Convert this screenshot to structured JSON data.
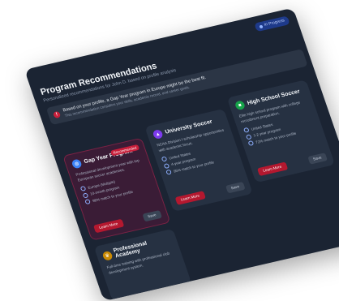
{
  "top_badge": "In Progress",
  "page": {
    "title": "Program Recommendations",
    "subtitle": "Personalized recommendations for John D. based on profile analysis"
  },
  "alert": {
    "title": "Based on your profile, a Gap Year program in Europe might be the best fit.",
    "subtitle": "This recommendation considers your skills, academic record, and career goals."
  },
  "cards": [
    {
      "title": "Gap Year Program",
      "badge": "Recommended",
      "desc": "Professional development year with top European soccer academies.",
      "items": [
        "Europe (Multiple)",
        "10-month program",
        "98% match to your profile"
      ],
      "learn_label": "Learn More",
      "save_label": "Save",
      "icon": "globe-icon",
      "icon_color": "#3b82f6"
    },
    {
      "title": "University Soccer",
      "desc": "NCAA Division I scholarship opportunities with academic focus.",
      "items": [
        "United States",
        "4-year program",
        "95% match to your profile"
      ],
      "learn_label": "Learn More",
      "save_label": "Save",
      "icon": "graduation-cap-icon",
      "icon_color": "#7c3aed"
    },
    {
      "title": "High School Soccer",
      "desc": "Elite high school program with college recruitment preparation.",
      "items": [
        "United States",
        "1-2 year program",
        "72% match to your profile"
      ],
      "learn_label": "Learn More",
      "save_label": "Save",
      "icon": "school-icon",
      "icon_color": "#16a34a"
    },
    {
      "title": "Professional Academy",
      "desc": "Full-time training with professional club development system.",
      "icon": "trophy-icon",
      "icon_color": "#ca8a04"
    }
  ],
  "colors": {
    "panel_bg": "#1b2433",
    "card_bg": "#263142",
    "accent_red": "#b4182f",
    "badge_blue": "#1e3a8a"
  }
}
